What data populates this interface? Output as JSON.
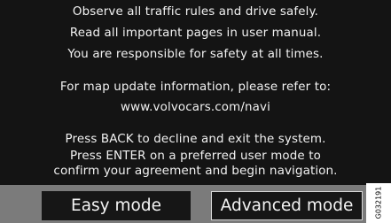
{
  "message": {
    "line1": "Observe all traffic rules and drive safely.",
    "line2": "Read all important pages in user manual.",
    "line3": "You are responsible for safety at all times.",
    "line4": "For map update information, please refer to:",
    "line5": "www.volvocars.com/navi",
    "line6": "Press BACK to decline and exit the system.",
    "line7": "Press ENTER on a preferred user mode to",
    "line8": "confirm your agreement and begin navigation."
  },
  "buttons": {
    "easy_label": "Easy mode",
    "advanced_label": "Advanced mode"
  },
  "figure_id": "G032191",
  "colors": {
    "screen_background": "#141414",
    "text": "#f2f2f2",
    "button_bar": "#7b7b7b",
    "button_background": "#161616",
    "selected_outline": "#d7d7d7"
  },
  "state": {
    "selected_button": "advanced"
  }
}
